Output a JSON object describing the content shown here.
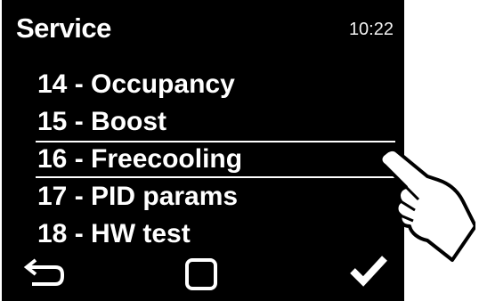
{
  "header": {
    "title": "Service",
    "time": "10:22"
  },
  "menu": {
    "items": [
      {
        "label": "14 - Occupancy"
      },
      {
        "label": "15 - Boost"
      },
      {
        "label": "16 - Freecooling"
      },
      {
        "label": "17 - PID params"
      },
      {
        "label": "18 - HW test"
      }
    ],
    "selected_index": 2
  },
  "footer": {
    "left_icon": "back-arrow-icon",
    "center_icon": "square-icon",
    "right_icon": "checkmark-icon"
  },
  "overlay_icon": "pointing-hand-icon",
  "colors": {
    "screen_background": "#000000",
    "text": "#ffffff",
    "page_background": "#ffffff"
  }
}
